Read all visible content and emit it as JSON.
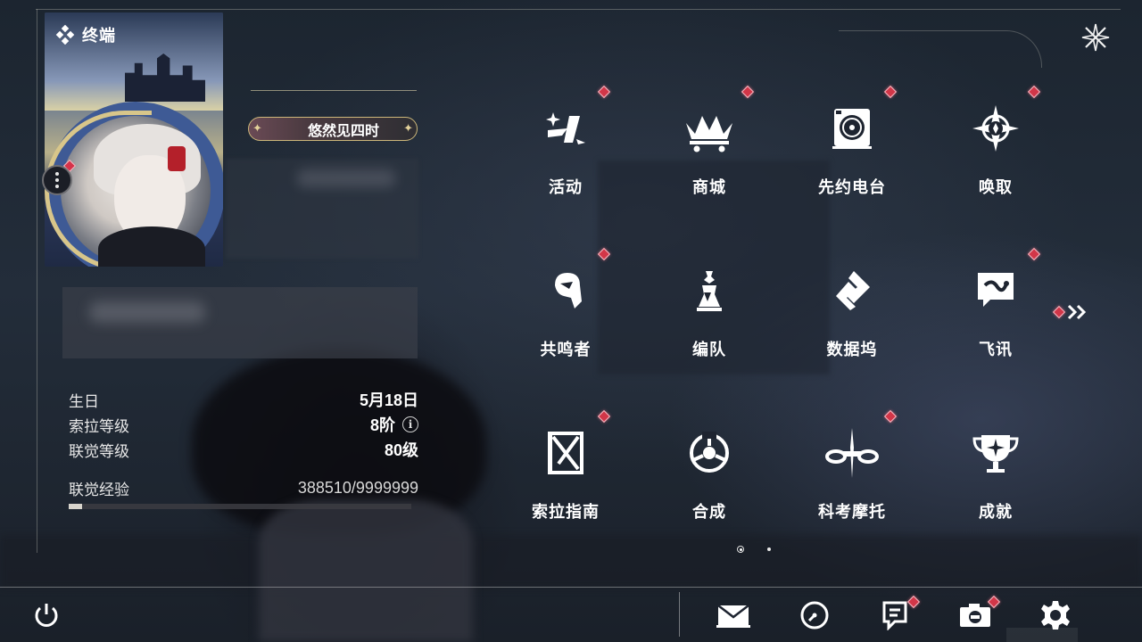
{
  "header": {
    "title": "终端",
    "icon": "diamond-cluster-icon"
  },
  "profile": {
    "title_badge": "悠然见四时",
    "stats": [
      {
        "label": "生日",
        "value": "5月18日"
      },
      {
        "label": "索拉等级",
        "value": "8阶",
        "info_icon": "i"
      },
      {
        "label": "联觉等级",
        "value": "80级"
      }
    ],
    "exp": {
      "label": "联觉经验",
      "value": "388510/9999999",
      "current": 388510,
      "max": 9999999
    }
  },
  "menu": {
    "items": [
      {
        "label": "活动",
        "icon": "activity-icon",
        "notification": true
      },
      {
        "label": "商城",
        "icon": "shop-cart-icon",
        "notification": true
      },
      {
        "label": "先约电台",
        "icon": "radio-icon",
        "notification": true
      },
      {
        "label": "唤取",
        "icon": "convene-compass-icon",
        "notification": true
      },
      {
        "label": "共鸣者",
        "icon": "resonator-head-icon",
        "notification": true
      },
      {
        "label": "编队",
        "icon": "chess-team-icon",
        "notification": false
      },
      {
        "label": "数据坞",
        "icon": "data-dock-icon",
        "notification": false
      },
      {
        "label": "飞讯",
        "icon": "message-chat-icon",
        "notification": true
      },
      {
        "label": "索拉指南",
        "icon": "guidebook-icon",
        "notification": true
      },
      {
        "label": "合成",
        "icon": "synthesis-icon",
        "notification": false
      },
      {
        "label": "科考摩托",
        "icon": "motorbike-icon",
        "notification": true
      },
      {
        "label": "成就",
        "icon": "trophy-icon",
        "notification": false
      }
    ],
    "pages": 2,
    "current_page": 1
  },
  "bottom_bar": [
    {
      "name": "power-button",
      "icon": "power-icon"
    },
    {
      "name": "mail-button",
      "icon": "mail-icon"
    },
    {
      "name": "clock-button",
      "icon": "clock-icon"
    },
    {
      "name": "notice-button",
      "icon": "notice-icon",
      "notification": true
    },
    {
      "name": "camera-button",
      "icon": "camera-icon",
      "notification": true
    },
    {
      "name": "settings-button",
      "icon": "gear-icon"
    }
  ],
  "colors": {
    "notification_red": "#d23648",
    "badge_gold": "#cdb77a",
    "ring_blue": "#3e5a95"
  }
}
